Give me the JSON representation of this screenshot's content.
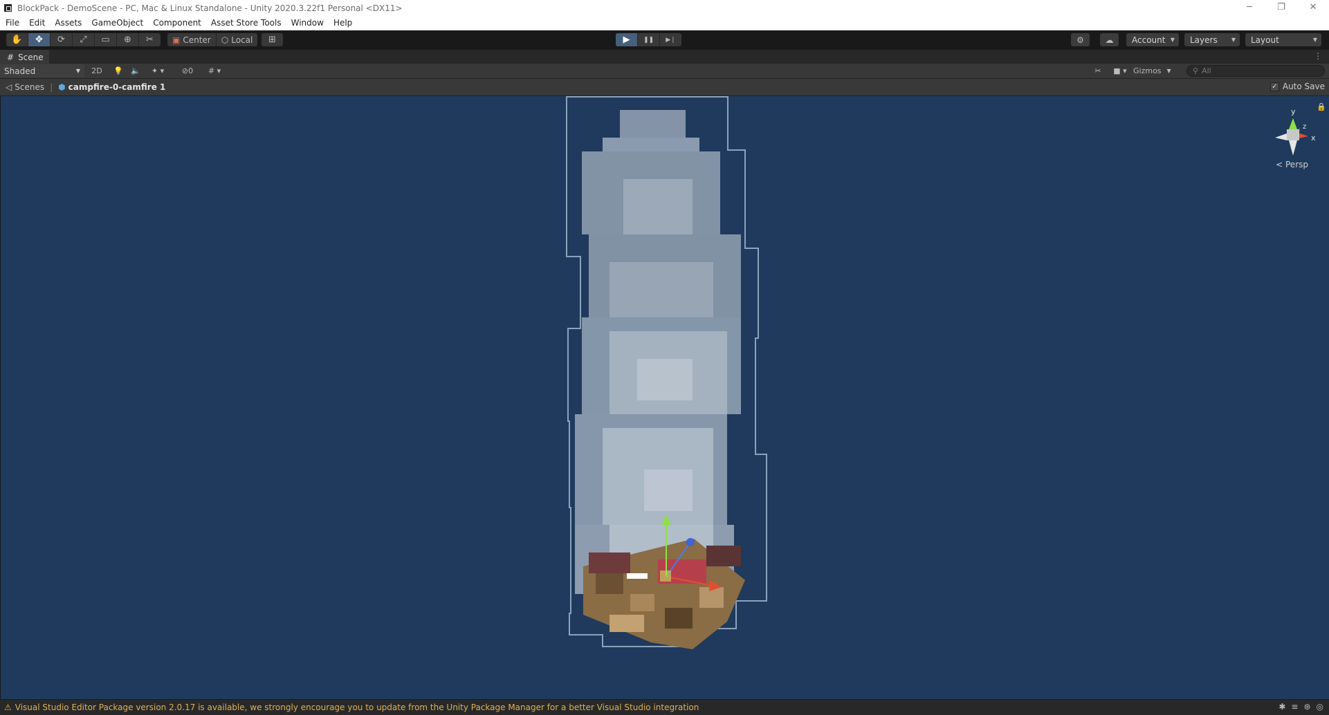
{
  "window": {
    "title": "BlockPack - DemoScene - PC, Mac & Linux Standalone - Unity 2020.3.22f1 Personal <DX11>",
    "controls": [
      "─",
      "❐",
      "✕"
    ]
  },
  "menu": [
    "File",
    "Edit",
    "Assets",
    "GameObject",
    "Component",
    "Asset Store Tools",
    "Window",
    "Help"
  ],
  "toolbar": {
    "tools": [
      {
        "name": "hand-tool-button",
        "glyph": "✋"
      },
      {
        "name": "move-tool-button",
        "glyph": "✥"
      },
      {
        "name": "rotate-tool-button",
        "glyph": "⟳"
      },
      {
        "name": "scale-tool-button",
        "glyph": "⤢"
      },
      {
        "name": "rect-tool-button",
        "glyph": "▭"
      },
      {
        "name": "transform-tool-button",
        "glyph": "⊕"
      },
      {
        "name": "custom-tool-button",
        "glyph": "✂"
      }
    ],
    "pivot_label": "Center",
    "space_label": "Local",
    "play_glyph": "▶",
    "pause_glyph": "❚❚",
    "step_glyph": "▶❘",
    "account_label": "Account",
    "layers_label": "Layers",
    "layout_label": "Layout"
  },
  "scene_tab": {
    "label": "Scene",
    "icon": "#",
    "menu_glyph": "⋮"
  },
  "scene_options": {
    "shading": "Shaded",
    "mode_2d": "2D",
    "hidden_count": "0",
    "gizmos_label": "Gizmos",
    "search_placeholder": "All"
  },
  "breadcrumb": {
    "root": "Scenes",
    "current": "campfire-0-camfire 1"
  },
  "autosave": {
    "label": "Auto Save",
    "checked": true
  },
  "gizmo": {
    "x": "x",
    "y": "y",
    "z": "z"
  },
  "persp_label": "Persp",
  "status": {
    "message": "Visual Studio Editor Package version 2.0.17 is available, we strongly encourage you to update from the Unity Package Manager for a better Visual Studio integration"
  },
  "colors": {
    "viewport_bg": "#1f3a5c",
    "accent": "#46607c",
    "warning": "#d9b25d"
  }
}
